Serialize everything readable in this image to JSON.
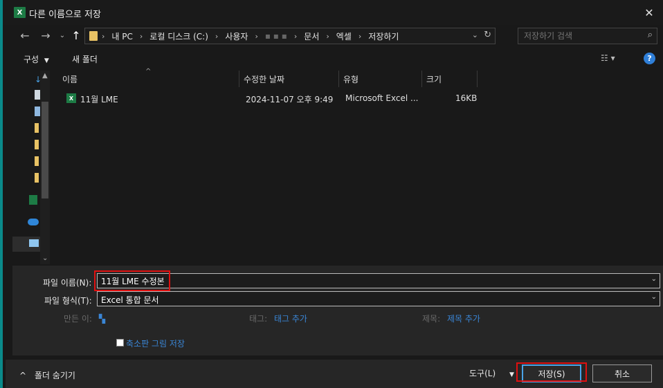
{
  "window": {
    "title": "다른 이름으로 저장",
    "app_icon_text": "X"
  },
  "nav": {
    "breadcrumbs": [
      "내 PC",
      "로컬 디스크 (C:)",
      "사용자",
      "문서",
      "엑셀",
      "저장하기"
    ],
    "search_placeholder": "저장하기 검색"
  },
  "toolbar": {
    "organize_label": "구성",
    "new_folder_label": "새 폴더"
  },
  "columns": [
    "이름",
    "수정한 날짜",
    "유형",
    "크기"
  ],
  "files": [
    {
      "name": "11월 LME",
      "modified": "2024-11-07 오후 9:49",
      "type": "Microsoft Excel ...",
      "size": "16KB"
    }
  ],
  "form": {
    "filename_label": "파일 이름(N):",
    "filename_value": "11월 LME 수정본",
    "filetype_label": "파일 형식(T):",
    "filetype_value": "Excel 통합 문서",
    "author_key": "만든 이:",
    "tags_key": "태그:",
    "tags_value": "태그 추가",
    "title_key": "제목:",
    "title_value": "제목 추가",
    "thumbnail_label": "축소판 그림 저장"
  },
  "footer": {
    "hide_folders_label": "폴더 숨기기",
    "tools_label": "도구(L)",
    "save_label": "저장(S)",
    "cancel_label": "취소"
  },
  "colors": {
    "accent": "#2f7fd8",
    "highlight": "#e01010",
    "excel": "#1d7b45",
    "link": "#3a86d6"
  }
}
